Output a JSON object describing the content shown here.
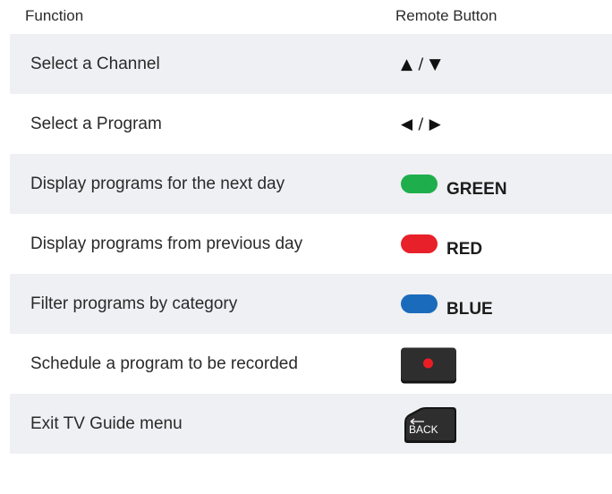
{
  "header": {
    "function_label": "Function",
    "button_label": "Remote Button"
  },
  "rows": [
    {
      "function": "Select a Channel",
      "button_type": "text",
      "button_text": "▲ / ▼"
    },
    {
      "function": "Select a Program",
      "button_type": "text",
      "button_text": "◀ / ▶"
    },
    {
      "function": "Display programs for the next day",
      "button_type": "color",
      "button_text": "GREEN",
      "color": "#1fae4c"
    },
    {
      "function": "Display programs from previous day",
      "button_type": "color",
      "button_text": "RED",
      "color": "#e8202a"
    },
    {
      "function": "Filter programs by category",
      "button_type": "color",
      "button_text": "BLUE",
      "color": "#1b6bbc"
    },
    {
      "function": "Schedule a program to be recorded",
      "button_type": "record-icon"
    },
    {
      "function": "Exit TV Guide menu",
      "button_type": "back-icon",
      "button_text": "BACK"
    }
  ]
}
